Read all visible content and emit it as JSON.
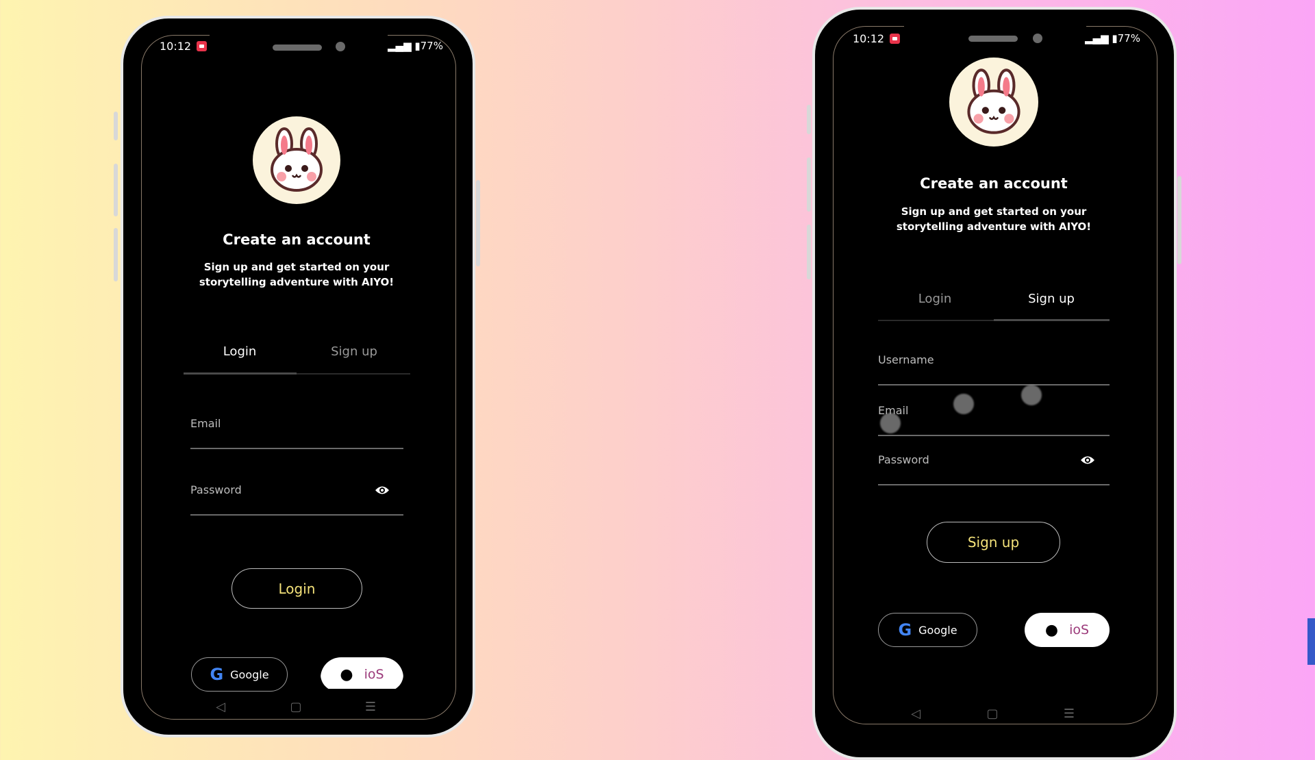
{
  "status": {
    "time": "10:12",
    "battery": "77%"
  },
  "left": {
    "title": "Create an account",
    "subtitle_line1": "Sign up and get started on your",
    "subtitle_line2": "storytelling adventure with AIYO!",
    "tabs": [
      {
        "label": "Login",
        "active": true
      },
      {
        "label": "Sign up",
        "active": false
      }
    ],
    "fields": [
      {
        "label": "Email"
      },
      {
        "label": "Password",
        "icon": "eye-icon"
      }
    ],
    "submit": "Login",
    "google": "Google",
    "ios": "ioS"
  },
  "right": {
    "title": "Create an account",
    "subtitle_line1": "Sign up and get started on your",
    "subtitle_line2": "storytelling adventure with AIYO!",
    "tabs": [
      {
        "label": "Login",
        "active": false
      },
      {
        "label": "Sign up",
        "active": true
      }
    ],
    "fields": [
      {
        "label": "Username"
      },
      {
        "label": "Email"
      },
      {
        "label": "Password",
        "icon": "eye-icon"
      }
    ],
    "submit": "Sign up",
    "google": "Google",
    "ios": "ioS"
  },
  "nav": {
    "back": "◁",
    "home": "▢",
    "menu": "☰"
  },
  "colors": {
    "accent": "#f4e27a",
    "ios_text": "#9b3a7a",
    "recording": "#e8334a"
  }
}
